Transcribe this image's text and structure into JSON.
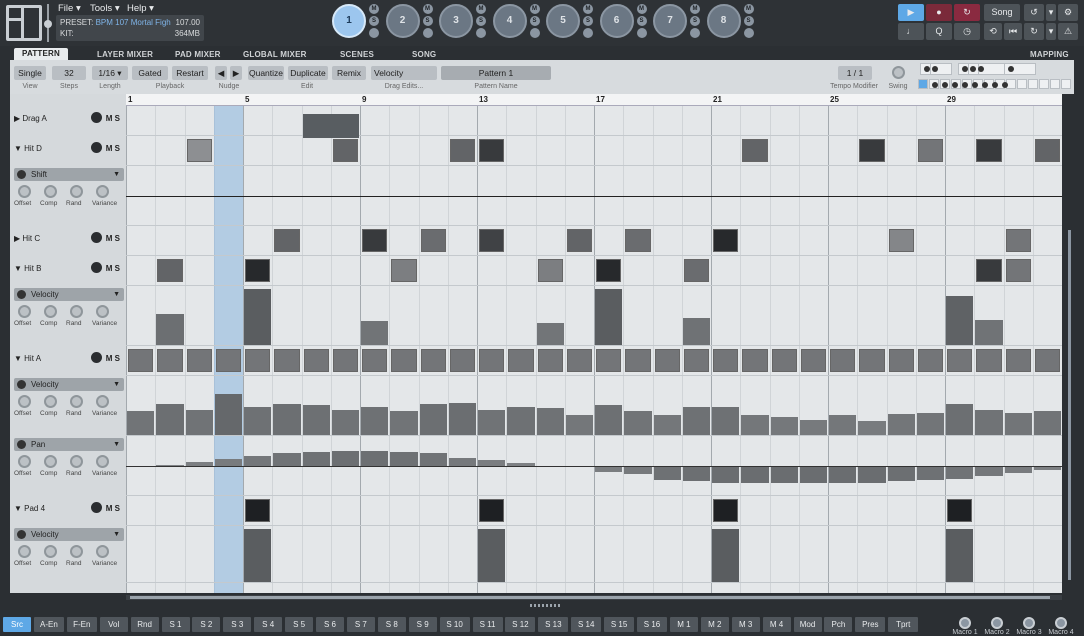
{
  "menu": [
    "File ▾",
    "Tools ▾",
    "Help ▾"
  ],
  "preset": {
    "preset_label": "PRESET:",
    "preset_value": "BPM 107 Mortal Figh",
    "tempo": "107.00",
    "kit_label": "KIT:",
    "memory": "364MB"
  },
  "pads": [
    {
      "label": "1",
      "active": true
    },
    {
      "label": "2",
      "active": false
    },
    {
      "label": "3",
      "active": false
    },
    {
      "label": "4",
      "active": false
    },
    {
      "label": "5",
      "active": false
    },
    {
      "label": "6",
      "active": false
    },
    {
      "label": "7",
      "active": false
    },
    {
      "label": "8",
      "active": false
    }
  ],
  "pad_buttons": [
    "M",
    "S"
  ],
  "transport": {
    "song_label": "Song",
    "q_label": "Q"
  },
  "tabs": [
    "PATTERN",
    "LAYER MIXER",
    "PAD MIXER",
    "GLOBAL MIXER",
    "SCENES",
    "SONG"
  ],
  "mapping_label": "MAPPING",
  "toolbar": {
    "view": "Single",
    "view_label": "View",
    "steps": "32",
    "steps_label": "Steps",
    "length": "1/16 ▾",
    "length_label": "Length",
    "gated": "Gated",
    "restart": "Restart",
    "playback_label": "Playback",
    "nudge_left": "◀",
    "nudge_right": "▶",
    "nudge_label": "Nudge",
    "quantize": "Quantize",
    "duplicate": "Duplicate",
    "remix": "Remix",
    "edit_label": "Edit",
    "drag_edit": "Velocity",
    "drag_edit_label": "Drag Edits...",
    "pattern_name": "Pattern 1",
    "pattern_name_label": "Pattern Name",
    "tempo_mod": "1 / 1",
    "tempo_mod_label": "Tempo Modifier",
    "swing_label": "Swing"
  },
  "ruler": [
    "1",
    "5",
    "9",
    "13",
    "17",
    "21",
    "25",
    "29"
  ],
  "tracks": [
    {
      "name": "Drag A",
      "open": "▶"
    },
    {
      "name": "Hit D",
      "open": "▼"
    },
    {
      "name": "Hit C",
      "open": "▶"
    },
    {
      "name": "Hit B",
      "open": "▼"
    },
    {
      "name": "Hit A",
      "open": "▼"
    },
    {
      "name": "Pad 4",
      "open": "▼"
    }
  ],
  "mod_lanes": [
    "Shift",
    "Velocity",
    "Velocity",
    "Pan",
    "Velocity"
  ],
  "knob_labels": [
    "Offset",
    "Comp",
    "Rand",
    "Variance"
  ],
  "ms_label": "M S",
  "grid_data": {
    "steps": 32,
    "highlight_step": 4,
    "drag_a": [
      {
        "start": 7,
        "len": 2
      }
    ],
    "hit_d": [
      {
        "step": 3,
        "level": 0.35
      },
      {
        "step": 8,
        "level": 0.6
      },
      {
        "step": 12,
        "level": 0.6
      },
      {
        "step": 13,
        "level": 0.85
      },
      {
        "step": 22,
        "level": 0.6
      },
      {
        "step": 26,
        "level": 0.85
      },
      {
        "step": 28,
        "level": 0.5
      },
      {
        "step": 30,
        "level": 0.85
      },
      {
        "step": 32,
        "level": 0.6
      }
    ],
    "hit_c": [
      {
        "step": 6,
        "level": 0.6
      },
      {
        "step": 9,
        "level": 0.85
      },
      {
        "step": 11,
        "level": 0.55
      },
      {
        "step": 13,
        "level": 0.8
      },
      {
        "step": 16,
        "level": 0.6
      },
      {
        "step": 18,
        "level": 0.55
      },
      {
        "step": 21,
        "level": 0.95
      },
      {
        "step": 27,
        "level": 0.4
      },
      {
        "step": 31,
        "level": 0.5
      }
    ],
    "hit_b": [
      {
        "step": 2,
        "level": 0.6
      },
      {
        "step": 5,
        "level": 0.95
      },
      {
        "step": 10,
        "level": 0.45
      },
      {
        "step": 15,
        "level": 0.45
      },
      {
        "step": 17,
        "level": 0.95
      },
      {
        "step": 20,
        "level": 0.55
      },
      {
        "step": 30,
        "level": 0.85
      },
      {
        "step": 31,
        "level": 0.5
      }
    ],
    "hit_b_velocity": [
      0,
      0.55,
      0,
      0,
      1,
      0,
      0,
      0,
      0.42,
      0,
      0,
      0,
      0,
      0,
      0.4,
      0,
      1,
      0,
      0,
      0.48,
      0,
      0,
      0,
      0,
      0,
      0,
      0,
      0,
      0.88,
      0.45,
      0,
      0
    ],
    "hit_a_velocity": [
      0.42,
      0.55,
      0.45,
      0.73,
      0.5,
      0.55,
      0.53,
      0.45,
      0.5,
      0.43,
      0.55,
      0.58,
      0.45,
      0.5,
      0.48,
      0.35,
      0.53,
      0.43,
      0.36,
      0.5,
      0.5,
      0.35,
      0.32,
      0.27,
      0.35,
      0.25,
      0.38,
      0.4,
      0.55,
      0.45,
      0.4,
      0.43
    ],
    "hit_a_pan": [
      0,
      0.05,
      0.15,
      0.25,
      0.35,
      0.45,
      0.5,
      0.55,
      0.55,
      0.5,
      0.45,
      0.3,
      0.2,
      0.1,
      0,
      -0.05,
      -0.2,
      -0.3,
      -0.5,
      -0.55,
      -0.6,
      -0.6,
      -0.6,
      -0.6,
      -0.6,
      -0.6,
      -0.55,
      -0.5,
      -0.45,
      -0.35,
      -0.25,
      -0.15
    ],
    "pad4": [
      5,
      13,
      21,
      29
    ],
    "pad4_velocity": [
      0,
      0,
      0,
      0,
      1,
      0,
      0,
      0,
      0,
      0,
      0,
      0,
      1,
      0,
      0,
      0,
      0,
      0,
      0,
      0,
      1,
      0,
      0,
      0,
      0,
      0,
      0,
      0,
      1,
      0,
      0,
      0
    ]
  },
  "bottom_tabs": [
    "Src",
    "A-En",
    "F-En",
    "Vol",
    "Rnd",
    "S 1",
    "S 2",
    "S 3",
    "S 4",
    "S 5",
    "S 6",
    "S 7",
    "S 8",
    "S 9",
    "S 10",
    "S 11",
    "S 12",
    "S 13",
    "S 14",
    "S 15",
    "S 16",
    "M 1",
    "M 2",
    "M 3",
    "M 4",
    "Mod",
    "Pch",
    "Pres",
    "Tprt"
  ],
  "macros": [
    "Macro 1",
    "Macro 2",
    "Macro 3",
    "Macro 4"
  ]
}
